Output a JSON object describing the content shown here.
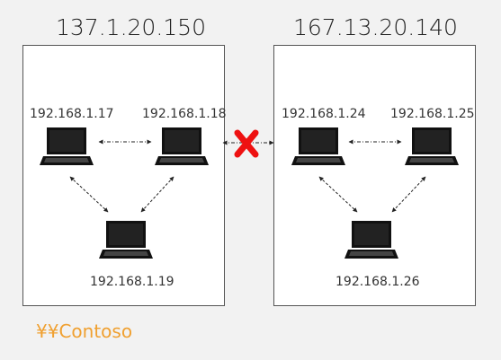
{
  "networks": [
    {
      "title": "137.1.20.150",
      "hosts": [
        "192.168.1.17",
        "192.168.1.18",
        "192.168.1.19"
      ]
    },
    {
      "title": "167.13.20.140",
      "hosts": [
        "192.168.1.24",
        "192.168.1.25",
        "192.168.1.26"
      ]
    }
  ],
  "share_path": "¥¥Contoso",
  "icons": {
    "computer": "laptop-icon",
    "blocked": "red-x-icon"
  },
  "colors": {
    "background": "#f2f2f2",
    "panel_fill": "#ffffff",
    "panel_border": "#555555",
    "laptop": "#111111",
    "blocked": "#ee1111",
    "share_path": "#f0a030"
  }
}
